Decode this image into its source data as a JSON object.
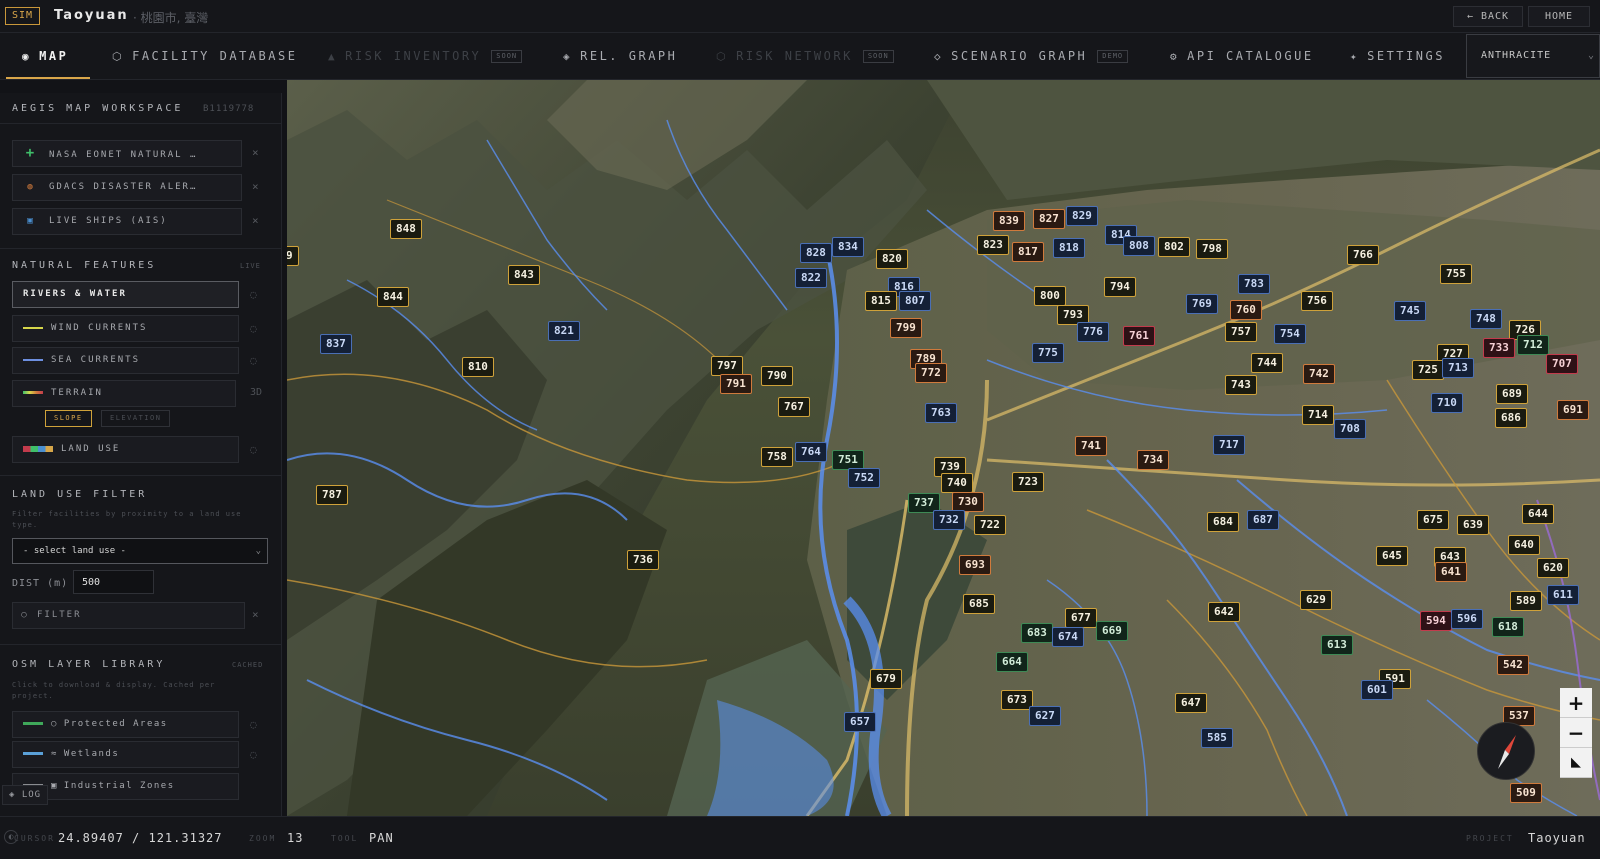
{
  "header": {
    "sim_badge": "SIM",
    "city": "Taoyuan",
    "city_sub": "· 桃園市, 臺灣",
    "back": "← BACK",
    "home": "HOME"
  },
  "nav": {
    "tabs": [
      {
        "icon": "◉",
        "label": "MAP",
        "tag": "",
        "state": "active"
      },
      {
        "icon": "⬡",
        "label": "FACILITY DATABASE",
        "tag": "",
        "state": "normal"
      },
      {
        "icon": "▲",
        "label": "RISK INVENTORY",
        "tag": "SOON",
        "state": "disabled"
      },
      {
        "icon": "◈",
        "label": "REL. GRAPH",
        "tag": "",
        "state": "normal"
      },
      {
        "icon": "⬡",
        "label": "RISK NETWORK",
        "tag": "SOON",
        "state": "disabled"
      },
      {
        "icon": "◇",
        "label": "SCENARIO GRAPH",
        "tag": "DEMO",
        "state": "normal"
      },
      {
        "icon": "⚙",
        "label": "API CATALOGUE",
        "tag": "",
        "state": "normal"
      },
      {
        "icon": "✦",
        "label": "SETTINGS",
        "tag": "",
        "state": "normal"
      }
    ],
    "theme": "ANTHRACITE"
  },
  "sidebar": {
    "title": "AEGIS MAP WORKSPACE",
    "id": "B1119778",
    "layers": [
      {
        "label": "NASA EONET NATURAL …",
        "icon": "plus",
        "color": "#3fbf6a"
      },
      {
        "label": "GDACS DISASTER ALER…",
        "icon": "circle",
        "color": "#d07a3c"
      },
      {
        "label": "LIVE SHIPS (AIS)",
        "icon": "square",
        "color": "#4a8fd0"
      }
    ],
    "natural": {
      "title": "NATURAL FEATURES",
      "badge": "LIVE",
      "items": [
        {
          "label": "RIVERS & WATER",
          "swatch": "",
          "active": true
        },
        {
          "label": "WIND CURRENTS",
          "swatch": "#d6d64a",
          "active": false
        },
        {
          "label": "SEA CURRENTS",
          "swatch": "#6d8fe0",
          "active": false
        },
        {
          "label": "TERRAIN",
          "swatch": "terrain",
          "active": false,
          "side": "3D"
        },
        {
          "label": "LAND USE",
          "swatch": "landuse",
          "active": false
        }
      ],
      "chips": [
        "SLOPE",
        "ELEVATION"
      ]
    },
    "landuse_filter": {
      "title": "LAND USE FILTER",
      "note": "Filter facilities by proximity to a land use type.",
      "select": "- select land use -",
      "dist_label": "DIST (m)",
      "dist_value": "500",
      "filter_label": "FILTER"
    },
    "osm": {
      "title": "OSM LAYER LIBRARY",
      "badge": "CACHED",
      "note": "Click to download & display. Cached per project.",
      "items": [
        {
          "label": "Protected Areas",
          "color": "#3fa85a",
          "icon": "○"
        },
        {
          "label": "Wetlands",
          "color": "#5aa0d8",
          "icon": "≈"
        },
        {
          "label": "Industrial Zones",
          "color": "#8a8c90",
          "icon": "▣"
        }
      ]
    },
    "log": "LOG"
  },
  "status": {
    "cursor_label": "CURSOR",
    "cursor_value": "24.89407 / 121.31327",
    "zoom_label": "ZOOM",
    "zoom_value": "13",
    "tool_label": "TOOL",
    "tool_value": "PAN",
    "project_label": "PROJECT",
    "project_value": "Taoyuan"
  },
  "map": {
    "zoom_in": "+",
    "zoom_out": "−",
    "markers": [
      {
        "t": "848",
        "c": "y"
      },
      {
        "t": "9",
        "c": "y"
      },
      {
        "t": "843",
        "c": "y"
      },
      {
        "t": "844",
        "c": "y"
      },
      {
        "t": "821",
        "c": "b"
      },
      {
        "t": "837",
        "c": "b"
      },
      {
        "t": "810",
        "c": "y"
      },
      {
        "t": "828",
        "c": "b"
      },
      {
        "t": "834",
        "c": "b"
      },
      {
        "t": "822",
        "c": "b"
      },
      {
        "t": "820",
        "c": "y"
      },
      {
        "t": "816",
        "c": "b"
      },
      {
        "t": "815",
        "c": "y"
      },
      {
        "t": "807",
        "c": "b"
      },
      {
        "t": "839",
        "c": "o"
      },
      {
        "t": "827",
        "c": "o"
      },
      {
        "t": "829",
        "c": "b"
      },
      {
        "t": "823",
        "c": "y"
      },
      {
        "t": "817",
        "c": "o"
      },
      {
        "t": "818",
        "c": "b"
      },
      {
        "t": "814",
        "c": "b"
      },
      {
        "t": "808",
        "c": "b"
      },
      {
        "t": "802",
        "c": "y"
      },
      {
        "t": "798",
        "c": "y"
      },
      {
        "t": "766",
        "c": "y"
      },
      {
        "t": "755",
        "c": "y"
      },
      {
        "t": "800",
        "c": "y"
      },
      {
        "t": "794",
        "c": "y"
      },
      {
        "t": "783",
        "c": "b"
      },
      {
        "t": "769",
        "c": "b"
      },
      {
        "t": "760",
        "c": "o"
      },
      {
        "t": "756",
        "c": "y"
      },
      {
        "t": "745",
        "c": "b"
      },
      {
        "t": "748",
        "c": "b"
      },
      {
        "t": "726",
        "c": "y"
      },
      {
        "t": "799",
        "c": "o"
      },
      {
        "t": "793",
        "c": "y"
      },
      {
        "t": "776",
        "c": "b"
      },
      {
        "t": "761",
        "c": "r"
      },
      {
        "t": "757",
        "c": "y"
      },
      {
        "t": "754",
        "c": "b"
      },
      {
        "t": "733",
        "c": "r"
      },
      {
        "t": "712",
        "c": "g"
      },
      {
        "t": "797",
        "c": "y"
      },
      {
        "t": "790",
        "c": "y"
      },
      {
        "t": "789",
        "c": "o"
      },
      {
        "t": "772",
        "c": "o"
      },
      {
        "t": "775",
        "c": "b"
      },
      {
        "t": "744",
        "c": "y"
      },
      {
        "t": "727",
        "c": "y"
      },
      {
        "t": "725",
        "c": "y"
      },
      {
        "t": "713",
        "c": "b"
      },
      {
        "t": "707",
        "c": "r"
      },
      {
        "t": "791",
        "c": "o"
      },
      {
        "t": "742",
        "c": "o"
      },
      {
        "t": "743",
        "c": "y"
      },
      {
        "t": "689",
        "c": "y"
      },
      {
        "t": "767",
        "c": "y"
      },
      {
        "t": "763",
        "c": "b"
      },
      {
        "t": "710",
        "c": "b"
      },
      {
        "t": "686",
        "c": "y"
      },
      {
        "t": "714",
        "c": "y"
      },
      {
        "t": "708",
        "c": "b"
      },
      {
        "t": "691",
        "c": "o"
      },
      {
        "t": "741",
        "c": "o"
      },
      {
        "t": "717",
        "c": "b"
      },
      {
        "t": "734",
        "c": "o"
      },
      {
        "t": "758",
        "c": "y"
      },
      {
        "t": "764",
        "c": "b"
      },
      {
        "t": "751",
        "c": "g"
      },
      {
        "t": "739",
        "c": "y"
      },
      {
        "t": "752",
        "c": "b"
      },
      {
        "t": "740",
        "c": "y"
      },
      {
        "t": "723",
        "c": "y"
      },
      {
        "t": "787",
        "c": "y"
      },
      {
        "t": "737",
        "c": "g"
      },
      {
        "t": "730",
        "c": "o"
      },
      {
        "t": "732",
        "c": "b"
      },
      {
        "t": "722",
        "c": "y"
      },
      {
        "t": "684",
        "c": "y"
      },
      {
        "t": "687",
        "c": "b"
      },
      {
        "t": "675",
        "c": "y"
      },
      {
        "t": "639",
        "c": "y"
      },
      {
        "t": "644",
        "c": "y"
      },
      {
        "t": "640",
        "c": "y"
      },
      {
        "t": "736",
        "c": "y"
      },
      {
        "t": "693",
        "c": "o"
      },
      {
        "t": "645",
        "c": "y"
      },
      {
        "t": "643",
        "c": "y"
      },
      {
        "t": "641",
        "c": "o"
      },
      {
        "t": "620",
        "c": "y"
      },
      {
        "t": "685",
        "c": "y"
      },
      {
        "t": "642",
        "c": "y"
      },
      {
        "t": "629",
        "c": "y"
      },
      {
        "t": "589",
        "c": "y"
      },
      {
        "t": "611",
        "c": "b"
      },
      {
        "t": "677",
        "c": "y"
      },
      {
        "t": "683",
        "c": "g"
      },
      {
        "t": "674",
        "c": "b"
      },
      {
        "t": "669",
        "c": "g"
      },
      {
        "t": "594",
        "c": "r"
      },
      {
        "t": "596",
        "c": "b"
      },
      {
        "t": "618",
        "c": "g"
      },
      {
        "t": "613",
        "c": "g"
      },
      {
        "t": "664",
        "c": "g"
      },
      {
        "t": "542",
        "c": "o"
      },
      {
        "t": "679",
        "c": "y"
      },
      {
        "t": "591",
        "c": "y"
      },
      {
        "t": "601",
        "c": "b"
      },
      {
        "t": "673",
        "c": "y"
      },
      {
        "t": "647",
        "c": "y"
      },
      {
        "t": "627",
        "c": "b"
      },
      {
        "t": "537",
        "c": "o"
      },
      {
        "t": "657",
        "c": "b"
      },
      {
        "t": "585",
        "c": "b"
      },
      {
        "t": "509",
        "c": "o"
      }
    ]
  }
}
